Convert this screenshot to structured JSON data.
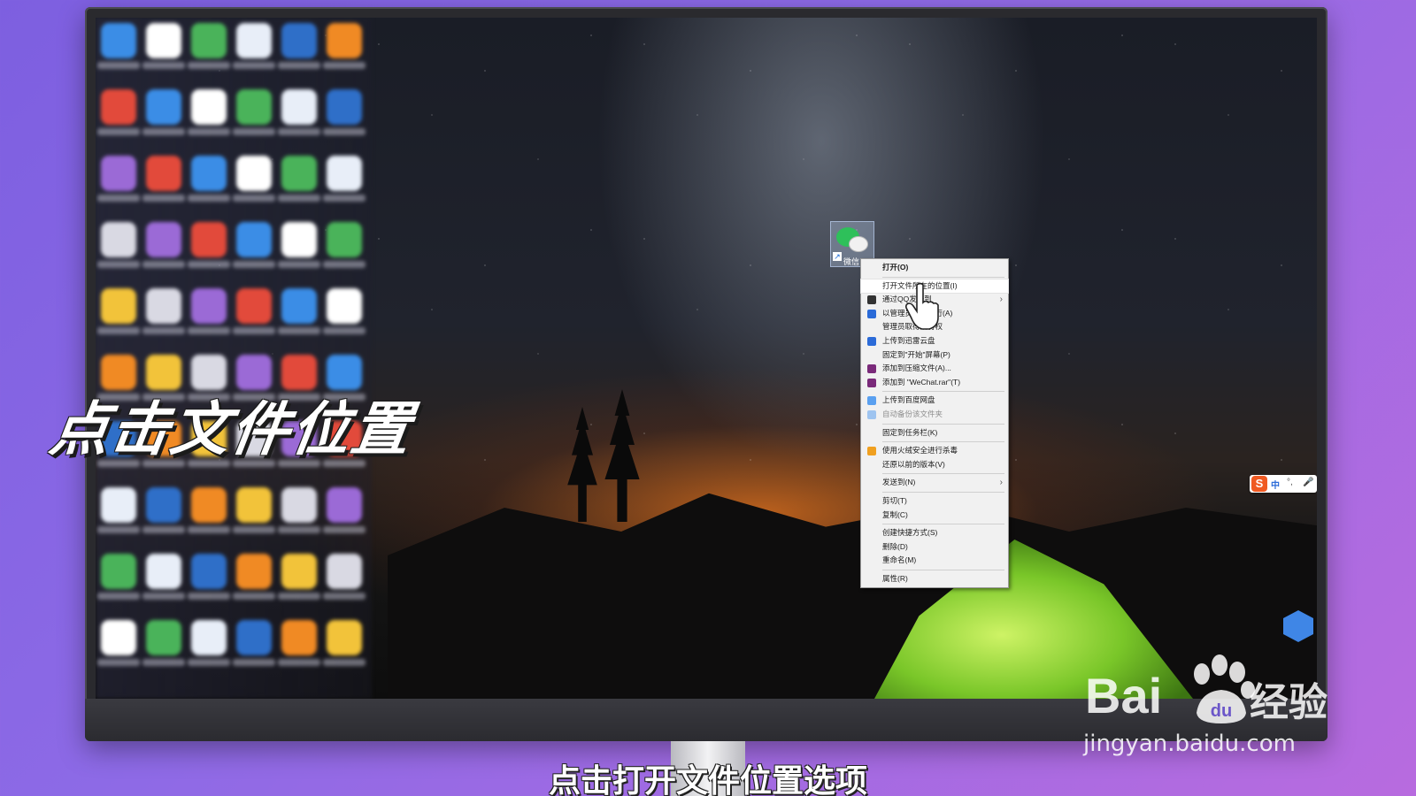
{
  "overlay": {
    "big_caption": "点击文件位置",
    "bottom_caption": "点击打开文件位置选项"
  },
  "desktop": {
    "selected_icon_label": "微信"
  },
  "context_menu": {
    "items": [
      {
        "label": "打开(O)",
        "bold": true
      },
      {
        "sep": true
      },
      {
        "label": "打开文件所在的位置(I)",
        "hover": true
      },
      {
        "label": "通过QQ发送到",
        "icon": "qq-icon",
        "icon_color": "#333333",
        "submenu": true
      },
      {
        "label": "以管理员身份运行(A)",
        "icon": "shield-icon",
        "icon_color": "#2b6bd8"
      },
      {
        "label": "管理员取得所有权"
      },
      {
        "label": "上传到迅雷云盘",
        "icon": "cloud-upload-icon",
        "icon_color": "#2b6bd8"
      },
      {
        "label": "固定到\"开始\"屏幕(P)"
      },
      {
        "label": "添加到压缩文件(A)...",
        "icon": "winrar-icon",
        "icon_color": "#7a2a7a"
      },
      {
        "label": "添加到 \"WeChat.rar\"(T)",
        "icon": "winrar-icon",
        "icon_color": "#7a2a7a"
      },
      {
        "sep": true
      },
      {
        "label": "上传到百度网盘",
        "icon": "baidu-netdisk-icon",
        "icon_color": "#5aa0f0"
      },
      {
        "label": "自动备份该文件夹",
        "icon": "baidu-netdisk-icon",
        "icon_color": "#9ec4f0",
        "disabled": true
      },
      {
        "sep": true
      },
      {
        "label": "固定到任务栏(K)"
      },
      {
        "sep": true
      },
      {
        "label": "使用火绒安全进行杀毒",
        "icon": "huorong-icon",
        "icon_color": "#f0a020"
      },
      {
        "label": "还原以前的版本(V)"
      },
      {
        "sep": true
      },
      {
        "label": "发送到(N)",
        "submenu": true
      },
      {
        "sep": true
      },
      {
        "label": "剪切(T)"
      },
      {
        "label": "复制(C)"
      },
      {
        "sep": true
      },
      {
        "label": "创建快捷方式(S)"
      },
      {
        "label": "删除(D)"
      },
      {
        "label": "重命名(M)"
      },
      {
        "sep": true
      },
      {
        "label": "属性(R)"
      }
    ]
  },
  "ime": {
    "logo": "S",
    "language": "中",
    "punctuation": "°,",
    "mic": "🎤"
  },
  "watermark": {
    "brand_latin": "Bai",
    "brand_du": "du",
    "brand_cn": "经验",
    "url": "jingyan.baidu.com"
  },
  "colors": {
    "background_accent": "#8d6ae6",
    "menu_background": "#f1f1f1",
    "wechat_green": "#2ec05a",
    "sogou_orange": "#f05a22"
  }
}
